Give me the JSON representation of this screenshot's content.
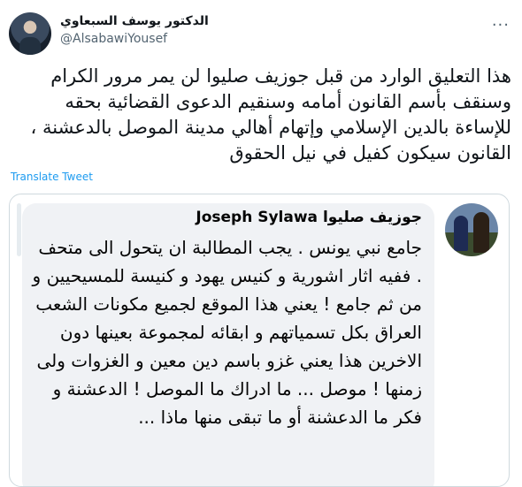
{
  "author": {
    "display_name": "الدكتور يوسف السبعاوي",
    "handle": "@AlsabawiYousef",
    "avatar_icon": "profile-photo-icon"
  },
  "tweet": {
    "text": "هذا التعليق الوارد من قبل جوزيف صليوا لن يمر مرور الكرام وسنقف بأسم القانون أمامه وسنقيم الدعوى القضائية بحقه للإساءة بالدين الإسلامي وإتهام أهالي مدينة الموصل بالدعشنة ، القانون سيكون كفيل في نيل الحقوق",
    "translate_label": "Translate Tweet"
  },
  "quoted": {
    "commenter_name": "جوزيف صليوا Joseph Sylawa",
    "comment_text": "جامع نبي يونس . يجب المطالبة ان يتحول الى متحف . ففيه اثار اشورية و كنيس يهود و كنيسة للمسيحيين و من ثم جامع ! يعني هذا الموقع لجميع مكونات الشعب العراق بكل تسمياتهم و ابقائه لمجموعة بعينها دون الاخرين هذا يعني غزو باسم دين معين و الغزوات ولى زمنها ! موصل ... ما ادراك ما الموصل ! الدعشنة و فكر ما الدعشنة أو ما تبقى منها ماذا ..."
  },
  "colors": {
    "link": "#1d9bf0",
    "secondary_text": "#536471",
    "border": "#cfd9de",
    "bubble": "#f0f2f5"
  }
}
